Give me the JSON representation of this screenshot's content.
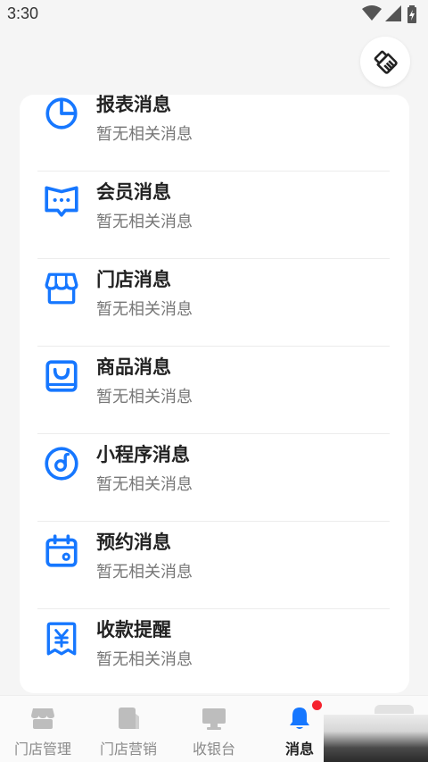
{
  "status_bar": {
    "time": "3:30"
  },
  "accent_color": "#1677ff",
  "messages": [
    {
      "title": "报表消息",
      "subtitle": "暂无相关消息",
      "icon": "pie-chart-icon"
    },
    {
      "title": "会员消息",
      "subtitle": "暂无相关消息",
      "icon": "chat-bubble-icon"
    },
    {
      "title": "门店消息",
      "subtitle": "暂无相关消息",
      "icon": "storefront-icon"
    },
    {
      "title": "商品消息",
      "subtitle": "暂无相关消息",
      "icon": "shopping-bag-icon"
    },
    {
      "title": "小程序消息",
      "subtitle": "暂无相关消息",
      "icon": "mini-program-icon"
    },
    {
      "title": "预约消息",
      "subtitle": "暂无相关消息",
      "icon": "calendar-icon"
    },
    {
      "title": "收款提醒",
      "subtitle": "暂无相关消息",
      "icon": "yuan-receipt-icon"
    }
  ],
  "tabbar": {
    "tabs": [
      {
        "label": "门店管理",
        "icon": "store-icon",
        "active": false
      },
      {
        "label": "门店营销",
        "icon": "marketing-icon",
        "active": false
      },
      {
        "label": "收银台",
        "icon": "monitor-icon",
        "active": false
      },
      {
        "label": "消息",
        "icon": "bell-icon",
        "active": true,
        "badge": true
      }
    ]
  }
}
